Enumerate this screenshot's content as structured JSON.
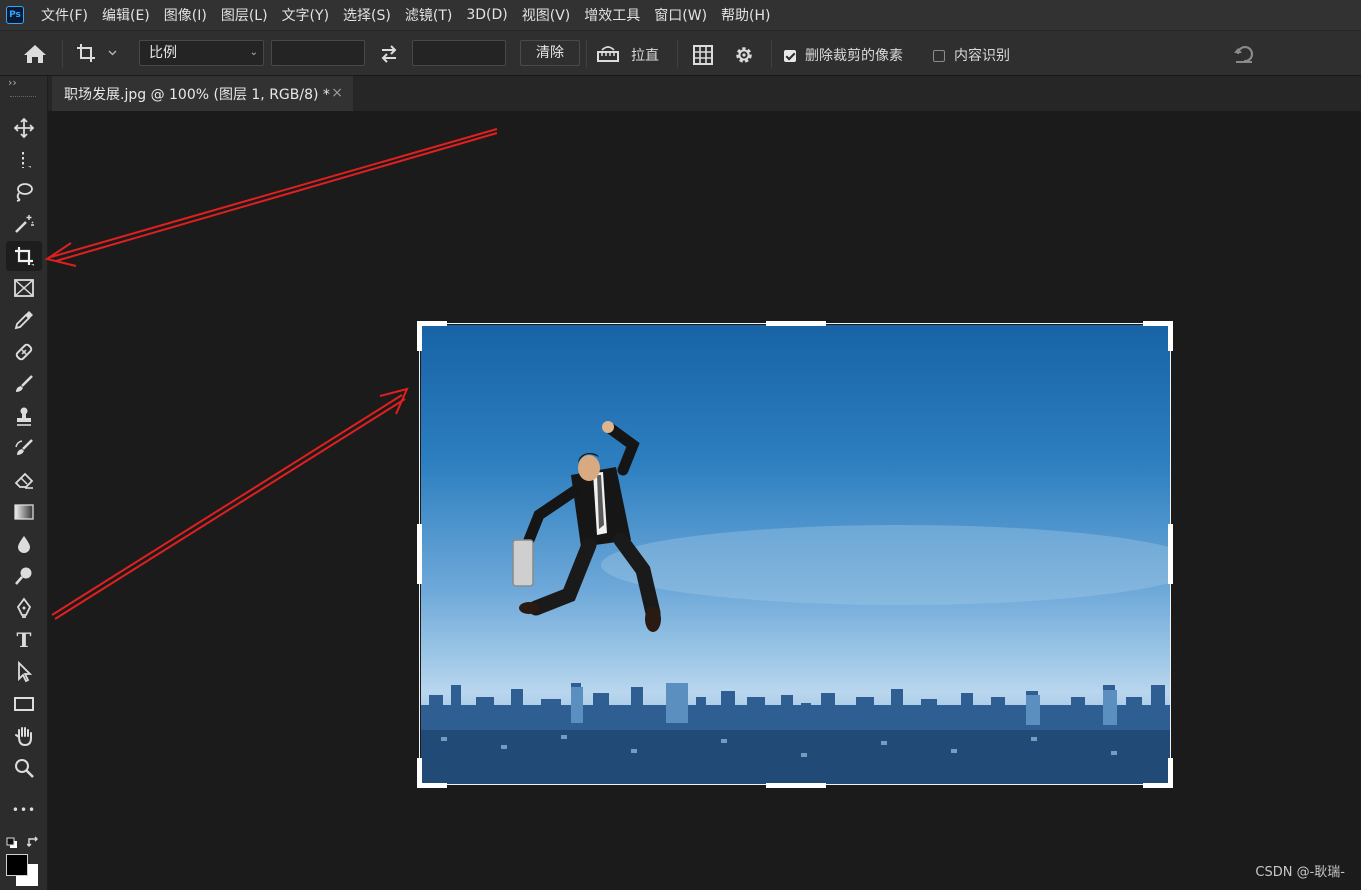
{
  "app": {
    "logo_text": "Ps"
  },
  "menu": [
    "文件(F)",
    "编辑(E)",
    "图像(I)",
    "图层(L)",
    "文字(Y)",
    "选择(S)",
    "滤镜(T)",
    "3D(D)",
    "视图(V)",
    "增效工具",
    "窗口(W)",
    "帮助(H)"
  ],
  "options": {
    "ratio_value": "比例",
    "width_value": "",
    "height_value": "",
    "clear_label": "清除",
    "straighten_label": "拉直",
    "delete_cropped_label": "删除裁剪的像素",
    "delete_cropped_checked": true,
    "content_aware_label": "内容识别",
    "content_aware_checked": false
  },
  "document_tab": {
    "title": "职场发展.jpg @ 100% (图层 1, RGB/8) *",
    "close_glyph": "×"
  },
  "toolbar": {
    "collapse_glyph": "››",
    "tools": [
      "move",
      "marquee",
      "lasso",
      "magic-wand",
      "crop",
      "frame",
      "eyedropper",
      "healing-brush",
      "brush",
      "clone-stamp",
      "history-brush",
      "eraser",
      "gradient",
      "blur",
      "dodge",
      "pen",
      "type",
      "path-selection",
      "rectangle",
      "hand",
      "zoom",
      "more"
    ],
    "active_tool": "crop",
    "more_glyph": "•••",
    "type_glyph": "T"
  },
  "watermark": "CSDN @-耿瑞-",
  "colors": {
    "annotation_arrow": "#e0201f",
    "foreground": "#000000",
    "background": "#ffffff"
  }
}
